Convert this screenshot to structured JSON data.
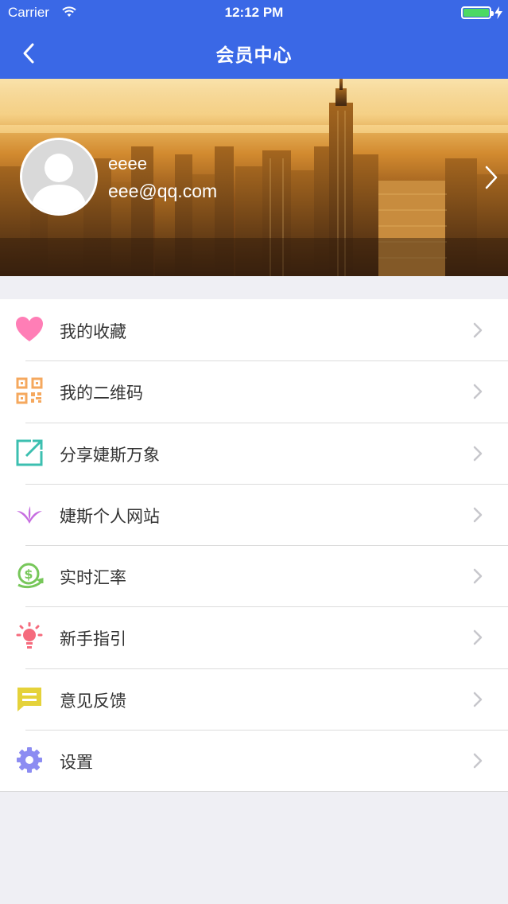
{
  "status_bar": {
    "carrier": "Carrier",
    "time": "12:12 PM"
  },
  "nav": {
    "title": "会员中心",
    "back_icon": "chevron-left-icon"
  },
  "profile": {
    "name": "eeee",
    "email": "eee@qq.com"
  },
  "menu": {
    "items": [
      {
        "label": "我的收藏",
        "icon": "heart-icon",
        "color": "#ff7eb6"
      },
      {
        "label": "我的二维码",
        "icon": "qrcode-icon",
        "color": "#f5a85e"
      },
      {
        "label": "分享婕斯万象",
        "icon": "share-icon",
        "color": "#3cbfb0"
      },
      {
        "label": "婕斯个人网站",
        "icon": "website-logo-icon",
        "color": "#c66ce0"
      },
      {
        "label": "实时汇率",
        "icon": "exchange-rate-icon",
        "color": "#77c75a"
      },
      {
        "label": "新手指引",
        "icon": "lightbulb-icon",
        "color": "#f56b7d"
      },
      {
        "label": "意见反馈",
        "icon": "feedback-icon",
        "color": "#e5d23a"
      },
      {
        "label": "设置",
        "icon": "gear-icon",
        "color": "#8c8cf2"
      }
    ]
  },
  "colors": {
    "accent": "#3a68e6",
    "background": "#efeff4"
  }
}
